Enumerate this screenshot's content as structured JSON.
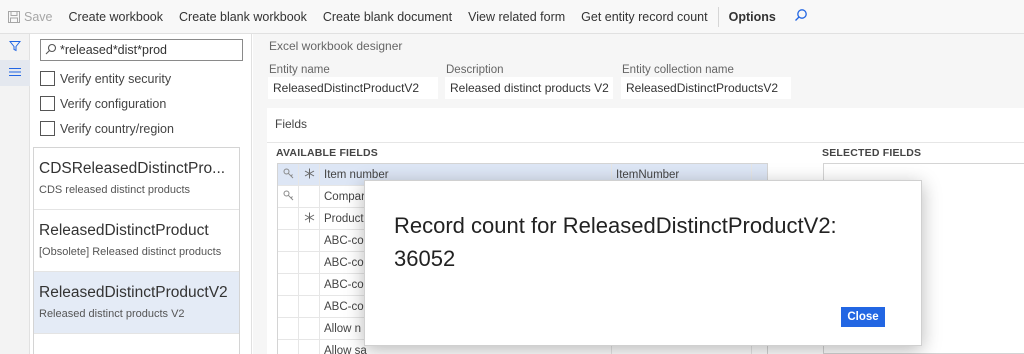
{
  "toolbar": {
    "save_label": "Save",
    "create_workbook": "Create workbook",
    "create_blank_workbook": "Create blank workbook",
    "create_blank_document": "Create blank document",
    "view_related_form": "View related form",
    "get_entity_record_count": "Get entity record count",
    "options": "Options"
  },
  "filter": {
    "value": "*released*dist*prod"
  },
  "checks": [
    "Verify entity security",
    "Verify configuration",
    "Verify country/region"
  ],
  "entities": [
    {
      "title": "CDSReleasedDistinctPro...",
      "subtitle": "CDS released distinct products",
      "selected": false
    },
    {
      "title": "ReleasedDistinctProduct",
      "subtitle": "[Obsolete] Released distinct products",
      "selected": false
    },
    {
      "title": "ReleasedDistinctProductV2",
      "subtitle": "Released distinct products V2",
      "selected": true
    }
  ],
  "designer": {
    "title": "Excel workbook designer",
    "entity_name_label": "Entity name",
    "entity_name": "ReleasedDistinctProductV2",
    "description_label": "Description",
    "description": "Released distinct products V2",
    "collection_label": "Entity collection name",
    "collection": "ReleasedDistinctProductsV2"
  },
  "fields": {
    "heading": "Fields",
    "available_label": "AVAILABLE FIELDS",
    "selected_label": "SELECTED FIELDS",
    "rows": [
      {
        "key": true,
        "req": true,
        "label": "Item number",
        "name": "ItemNumber",
        "selected": true
      },
      {
        "key": true,
        "req": false,
        "label": "Compar",
        "name": "",
        "selected": false
      },
      {
        "key": false,
        "req": true,
        "label": "Product",
        "name": "",
        "selected": false
      },
      {
        "key": false,
        "req": false,
        "label": "ABC-cod",
        "name": "",
        "selected": false
      },
      {
        "key": false,
        "req": false,
        "label": "ABC-cod",
        "name": "",
        "selected": false
      },
      {
        "key": false,
        "req": false,
        "label": "ABC-cod",
        "name": "",
        "selected": false
      },
      {
        "key": false,
        "req": false,
        "label": "ABC-cod",
        "name": "",
        "selected": false
      },
      {
        "key": false,
        "req": false,
        "label": "Allow n",
        "name": "",
        "selected": false
      },
      {
        "key": false,
        "req": false,
        "label": "Allow sa",
        "name": "",
        "selected": false
      }
    ]
  },
  "dialog": {
    "message_line1": "Record count for ReleasedDistinctProductV2:",
    "message_line2": "36052",
    "close_label": "Close"
  },
  "colors": {
    "accent": "#2266e3",
    "selection": "#e4ebf6"
  },
  "icons": [
    "save-icon",
    "search-icon",
    "filter-icon",
    "list-icon",
    "key-icon",
    "asterisk-icon"
  ]
}
